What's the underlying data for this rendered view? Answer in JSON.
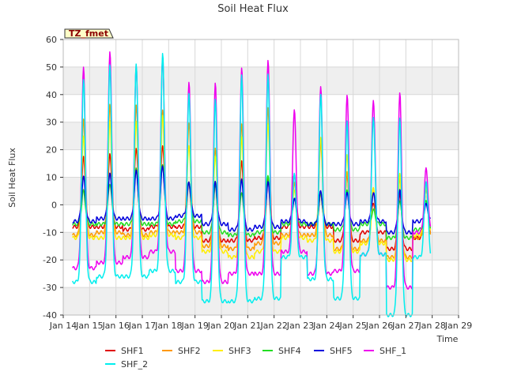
{
  "chart_data": {
    "type": "line",
    "title": "Soil Heat Flux",
    "xlabel": "Time",
    "ylabel": "Soil Heat Flux",
    "badge": "TZ_fmet",
    "ylim": [
      -40,
      60
    ],
    "xlim": [
      0,
      15
    ],
    "x_ticks": [
      {
        "value": 0,
        "label": "Jan 14"
      },
      {
        "value": 1,
        "label": "Jan 15"
      },
      {
        "value": 2,
        "label": "Jan 16"
      },
      {
        "value": 3,
        "label": "Jan 17"
      },
      {
        "value": 4,
        "label": "Jan 18"
      },
      {
        "value": 5,
        "label": "Jan 19"
      },
      {
        "value": 6,
        "label": "Jan 20"
      },
      {
        "value": 7,
        "label": "Jan 21"
      },
      {
        "value": 8,
        "label": "Jan 22"
      },
      {
        "value": 9,
        "label": "Jan 23"
      },
      {
        "value": 10,
        "label": "Jan 24"
      },
      {
        "value": 11,
        "label": "Jan 25"
      },
      {
        "value": 12,
        "label": "Jan 26"
      },
      {
        "value": 13,
        "label": "Jan 27"
      },
      {
        "value": 14,
        "label": "Jan 28"
      },
      {
        "value": 15,
        "label": "Jan 29"
      }
    ],
    "y_ticks": [
      -40,
      -30,
      -20,
      -10,
      0,
      10,
      20,
      30,
      40,
      50,
      60
    ],
    "grid": true,
    "legend_position": "bottom",
    "series": [
      {
        "name": "SHF1",
        "color": "#e00000",
        "peaks": [
          17,
          18,
          21,
          22,
          8,
          8,
          16,
          9,
          11,
          4,
          11,
          1,
          4,
          6
        ],
        "troughs": [
          -8,
          -8,
          -9,
          -8,
          -8,
          -13,
          -13,
          -12,
          -8,
          -8,
          -13,
          -10,
          -16,
          -12
        ]
      },
      {
        "name": "SHF2",
        "color": "#ff9900",
        "peaks": [
          31,
          36,
          36,
          35,
          30,
          20,
          30,
          35,
          8,
          22,
          12,
          6,
          10,
          8
        ],
        "troughs": [
          -11,
          -10,
          -11,
          -10,
          -10,
          -15,
          -16,
          -14,
          -11,
          -11,
          -16,
          -13,
          -19,
          -12
        ]
      },
      {
        "name": "SHF3",
        "color": "#ffee00",
        "peaks": [
          25,
          30,
          30,
          32,
          22,
          18,
          25,
          30,
          6,
          25,
          18,
          6,
          11,
          6
        ],
        "troughs": [
          -12,
          -12,
          -12,
          -11,
          -12,
          -17,
          -19,
          -17,
          -12,
          -13,
          -17,
          -14,
          -20,
          -11
        ]
      },
      {
        "name": "SHF4",
        "color": "#22dd22",
        "peaks": [
          5,
          8,
          13,
          15,
          8,
          7,
          5,
          11,
          2,
          4,
          5,
          -2,
          2,
          2
        ],
        "troughs": [
          -7,
          -7,
          -7,
          -7,
          -6,
          -10,
          -11,
          -10,
          -7,
          -7,
          -9,
          -7,
          -12,
          -9
        ]
      },
      {
        "name": "SHF5",
        "color": "#0000dd",
        "peaks": [
          10,
          11,
          12,
          14,
          8,
          8,
          9,
          8,
          2,
          5,
          4,
          4,
          5,
          0
        ],
        "troughs": [
          -6,
          -5,
          -5,
          -5,
          -4,
          -7,
          -9,
          -8,
          -6,
          -7,
          -7,
          -6,
          -10,
          -6
        ]
      },
      {
        "name": "SHF_1",
        "color": "#ee00ee",
        "peaks": [
          50,
          55,
          50,
          54,
          44,
          44,
          50,
          52,
          34,
          43,
          40,
          38,
          41,
          13
        ],
        "troughs": [
          -23,
          -21,
          -19,
          -17,
          -24,
          -28,
          -25,
          -25,
          -17,
          -25,
          -24,
          -18,
          -30,
          -10
        ]
      },
      {
        "name": "SHF_2",
        "color": "#00eeee",
        "peaks": [
          46,
          51,
          51,
          55,
          41,
          38,
          47,
          47,
          12,
          40,
          30,
          32,
          31,
          9
        ],
        "troughs": [
          -28,
          -26,
          -26,
          -24,
          -28,
          -35,
          -35,
          -34,
          -19,
          -27,
          -34,
          -18,
          -40,
          -19
        ]
      }
    ]
  }
}
